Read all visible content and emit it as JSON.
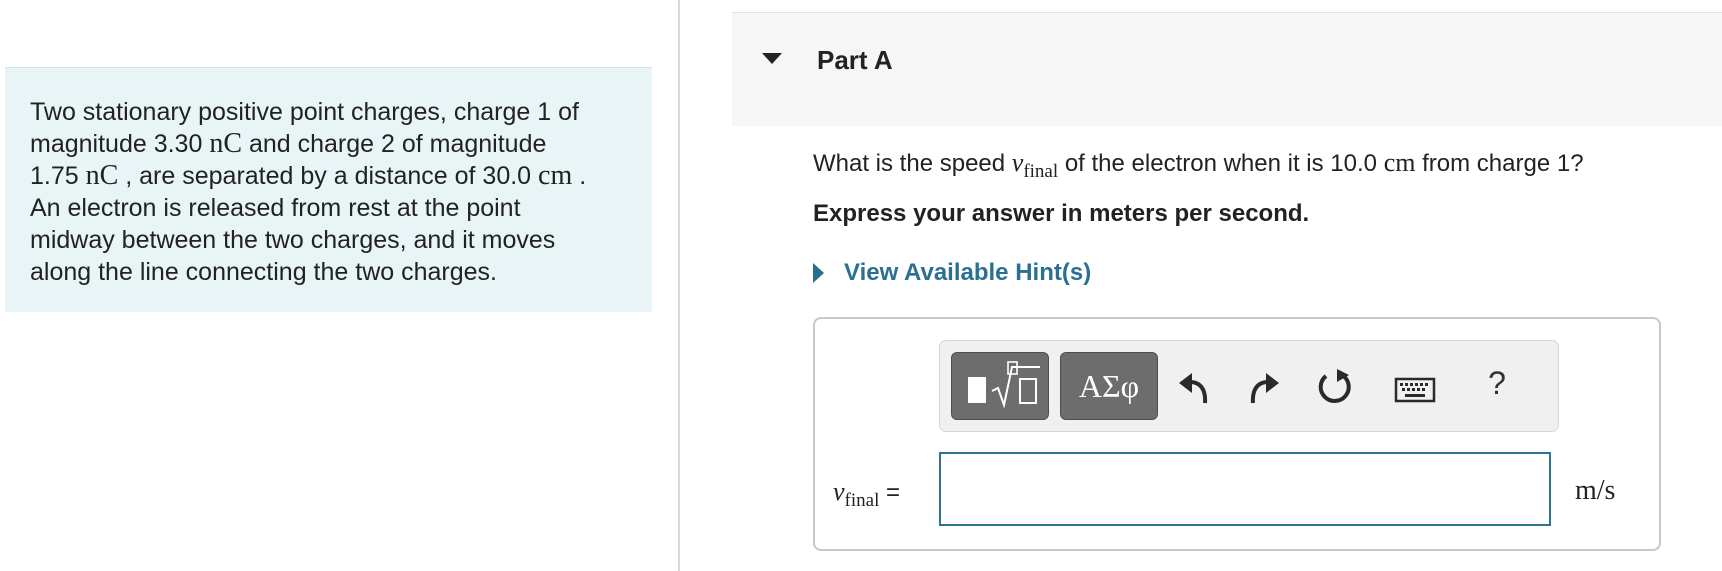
{
  "problem": {
    "t1": "Two stationary positive point charges, charge 1 of",
    "t2": "magnitude 3.30",
    "charge1_unit": "nC",
    "t3": " and charge 2 of magnitude",
    "t4": "1.75",
    "charge2_unit": "nC",
    "t5": " , are separated by a distance of 30.0",
    "distance_unit": "cm",
    "t6": " .",
    "t7": "An electron is released from rest at the point",
    "t8": "midway between the two charges, and it moves",
    "t9": "along the line connecting the two charges."
  },
  "part": {
    "title": "Part A",
    "question_pre": "What is the speed ",
    "var_symbol": "v",
    "var_sub": "final",
    "question_mid": " of the electron when it is 10.0",
    "question_unit": "cm",
    "question_post": " from charge 1?",
    "instruction": "Express your answer in meters per second.",
    "hint_label": "View Available Hint(s)"
  },
  "toolbar": {
    "symbols_label": "ΑΣφ",
    "help_label": "?",
    "icons": [
      "templates-icon",
      "greek-symbols-icon",
      "undo-icon",
      "redo-icon",
      "reset-icon",
      "keyboard-icon",
      "help-icon"
    ]
  },
  "answer": {
    "label_var": "v",
    "label_sub": "final",
    "label_eq": " =",
    "value": "",
    "unit": "m/s"
  },
  "colors": {
    "problem_bg": "#e9f4f6",
    "hint_link": "#2b7092",
    "input_border": "#2f7295",
    "toolbar_button": "#6d6d6d"
  }
}
